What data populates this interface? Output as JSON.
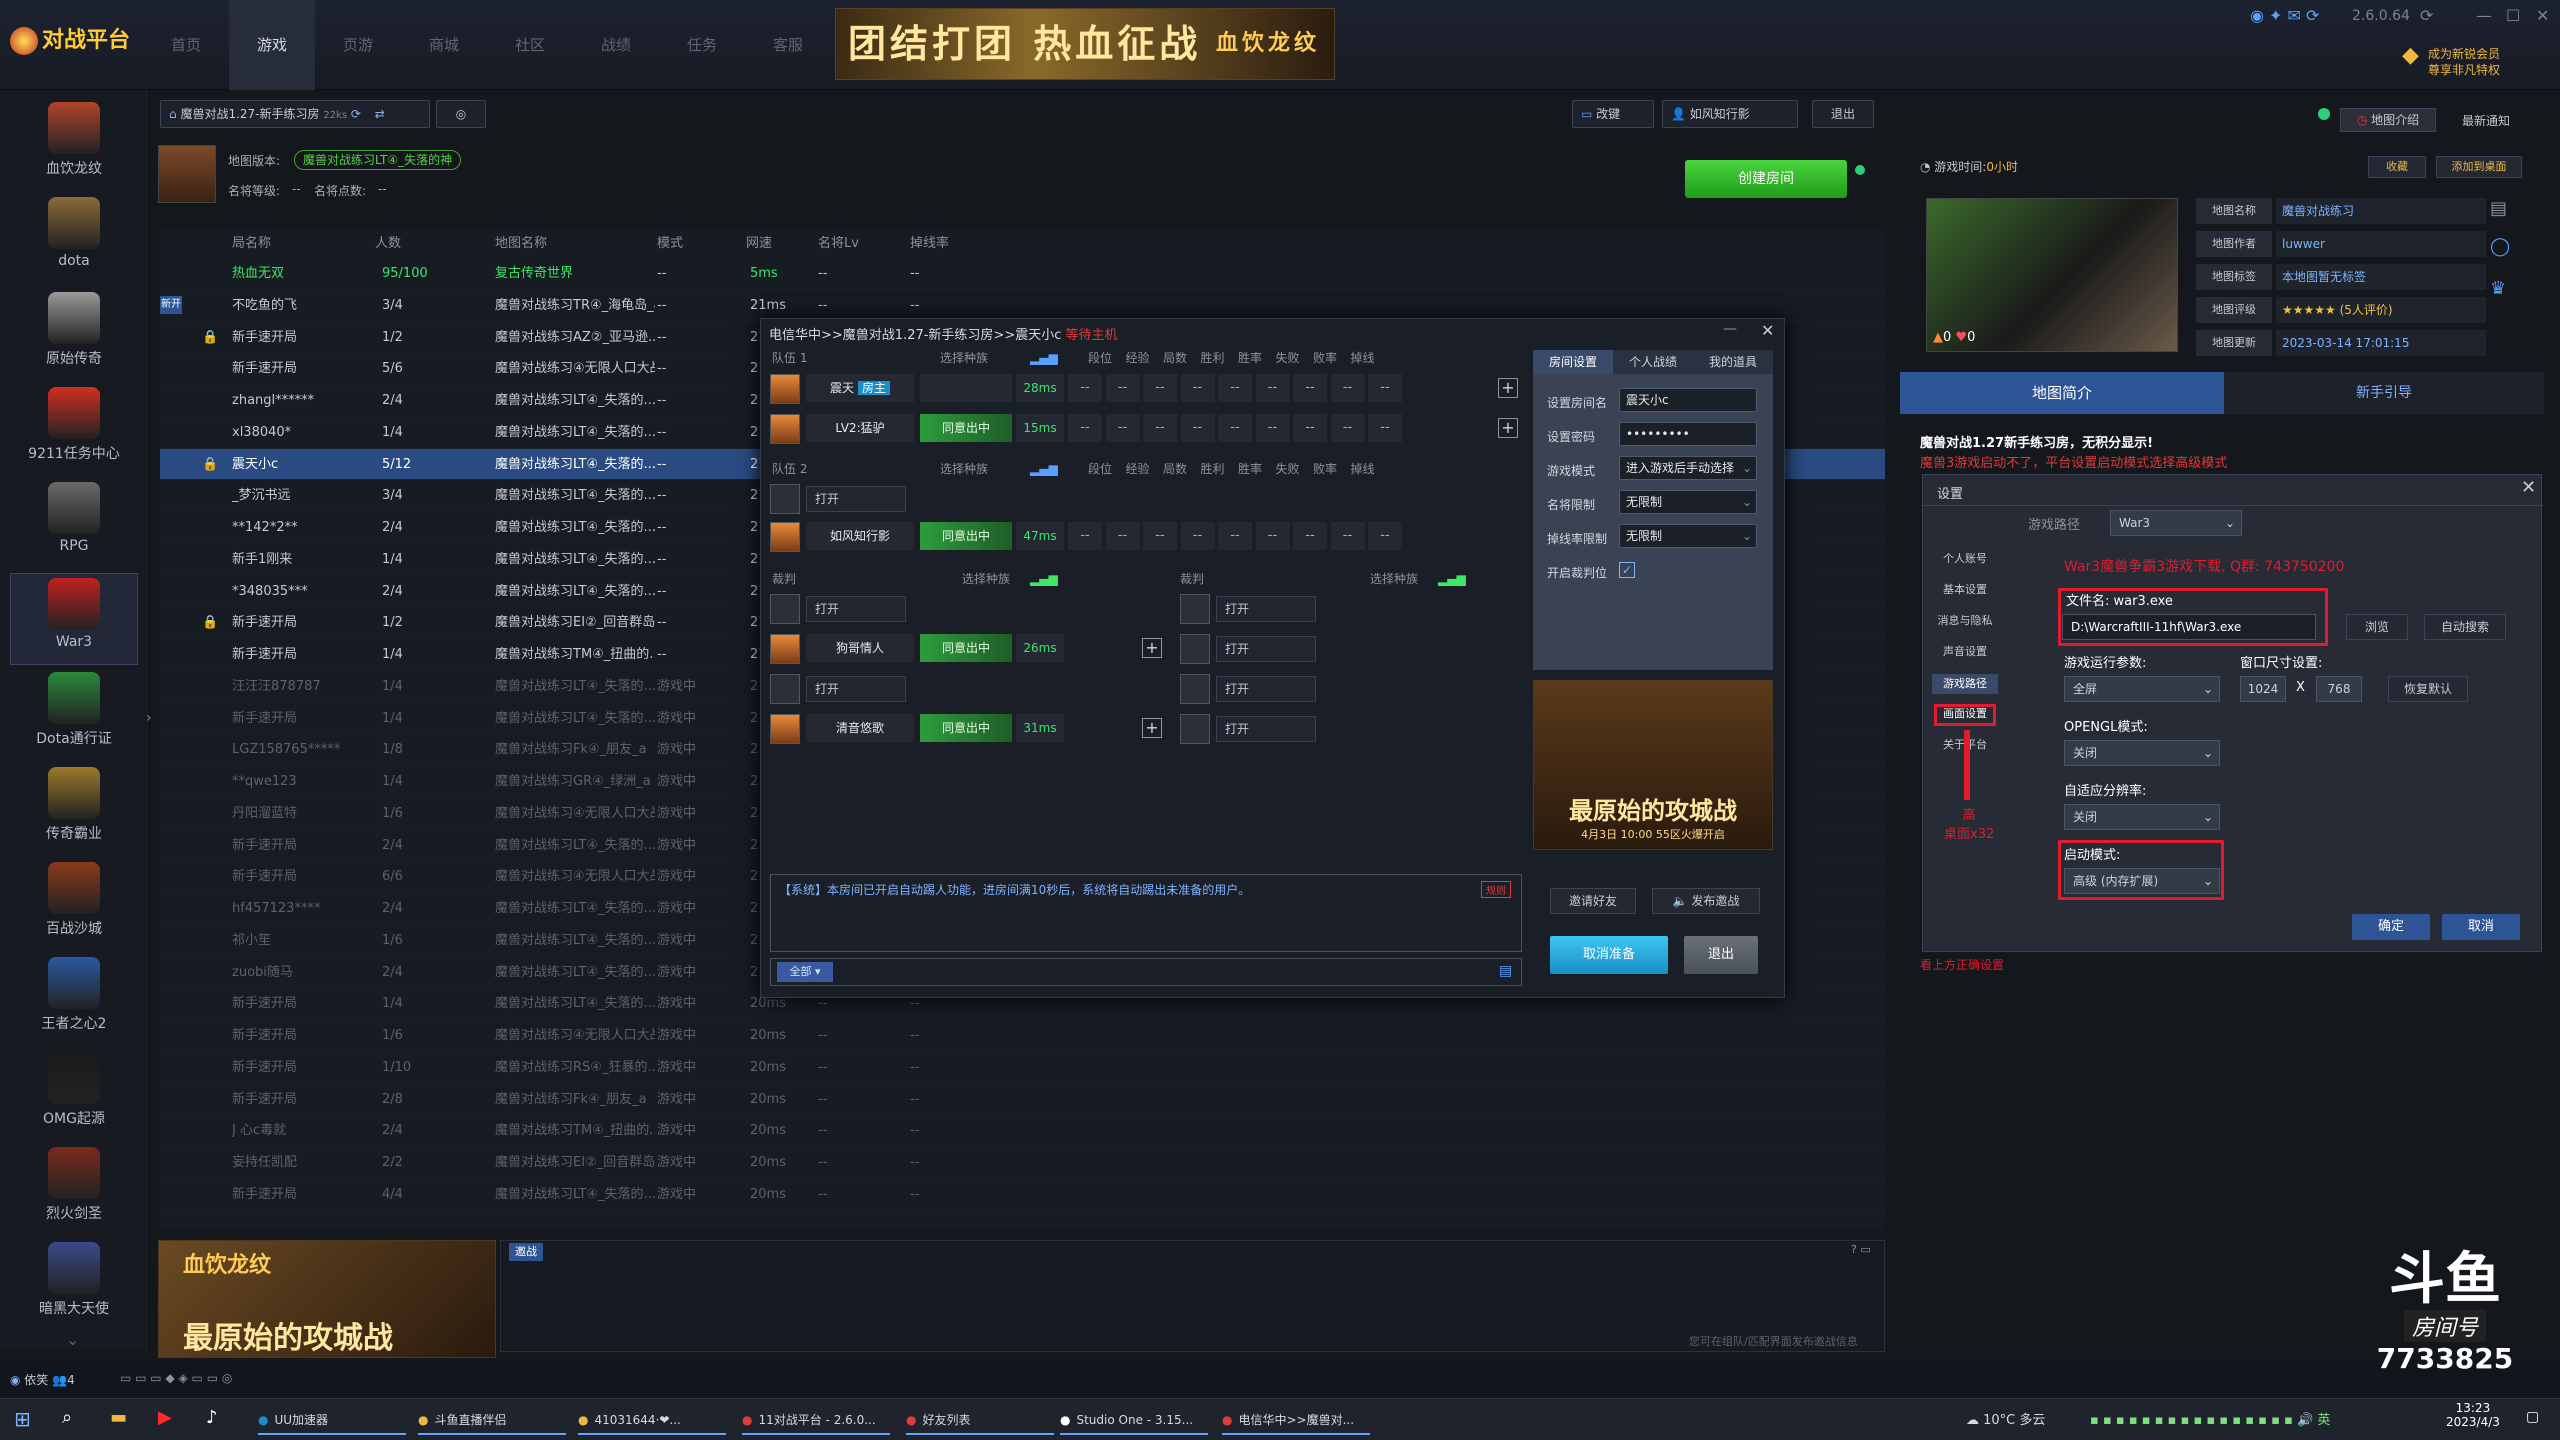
{
  "app": {
    "logo": "对战平台",
    "nav_tabs": [
      "首页",
      "游戏",
      "页游",
      "商城",
      "社区",
      "战绩",
      "任务",
      "客服"
    ],
    "version": "2.6.0.64",
    "vip_text_1": "成为新锐会员",
    "vip_text_2": "尊享非凡特权",
    "banner_text": "团结打团 热血征战",
    "banner_badge": "血饮龙纹"
  },
  "sidebar": [
    {
      "label": "血饮龙纹",
      "color": "#b0452a"
    },
    {
      "label": "dota",
      "color": "#8a6a3a"
    },
    {
      "label": "原始传奇",
      "color": "#9a9a9a"
    },
    {
      "label": "9211任务中心",
      "color": "#d03020"
    },
    {
      "label": "RPG",
      "color": "#6a6a6a"
    },
    {
      "label": "War3",
      "color": "#c02020"
    },
    {
      "label": "Dota通行证",
      "color": "#2a8a3a"
    },
    {
      "label": "传奇霸业",
      "color": "#9a7a2a"
    },
    {
      "label": "百战沙城",
      "color": "#8a3a1a"
    },
    {
      "label": "王者之心2",
      "color": "#2a5aa0"
    },
    {
      "label": "OMG起源",
      "color": "#1a1a1a"
    },
    {
      "label": "烈火剑圣",
      "color": "#7a2a1a"
    },
    {
      "label": "暗黑大天使",
      "color": "#3a4a8a"
    }
  ],
  "toolbar": {
    "room_path": "魔兽对战1.27-新手练习房",
    "room_count": "22ks",
    "btn_reconnect": "改键",
    "btn_fly": "如风知行影",
    "btn_exit": "退出",
    "create_room": "创建房间",
    "map_version_label": "地图版本:",
    "map_version_value": "魔兽对战练习LT④_失落的神",
    "fame_label": "名将等级:",
    "fame_value": "--",
    "fame_points_label": "名将点数:",
    "fame_points_value": "--"
  },
  "room_table": {
    "headers": [
      "局名称",
      "人数",
      "地图名称",
      "模式",
      "网速",
      "名将Lv",
      "掉线率"
    ],
    "rows": [
      [
        "热血无双",
        "95/100",
        "复古传奇世界",
        "--",
        "5ms",
        "--",
        "--"
      ],
      [
        "不吃鱼的飞",
        "3/4",
        "魔兽对战练习TR④_海龟岛_a",
        "--",
        "21ms",
        "--",
        "--"
      ],
      [
        "新手速开局",
        "1/2",
        "魔兽对战练习AZ②_亚马逊...",
        "--",
        "21",
        "",
        ""
      ],
      [
        "新手速开局",
        "5/6",
        "魔兽对战练习④无限人口大战",
        "--",
        "21",
        "",
        ""
      ],
      [
        "zhangl******",
        "2/4",
        "魔兽对战练习LT④_失落的...",
        "--",
        "21",
        "",
        ""
      ],
      [
        "xl38040*",
        "1/4",
        "魔兽对战练习LT④_失落的...",
        "--",
        "21",
        "",
        ""
      ],
      [
        "震天小c",
        "5/12",
        "魔兽对战练习LT④_失落的...",
        "--",
        "21",
        "",
        ""
      ],
      [
        "_梦沉书远",
        "3/4",
        "魔兽对战练习LT④_失落的...",
        "--",
        "21",
        "",
        ""
      ],
      [
        "**142*2**",
        "2/4",
        "魔兽对战练习LT④_失落的...",
        "--",
        "21",
        "",
        ""
      ],
      [
        "新手1刚来",
        "1/4",
        "魔兽对战练习LT④_失落的...",
        "--",
        "21",
        "",
        ""
      ],
      [
        "*348035***",
        "2/4",
        "魔兽对战练习LT④_失落的...",
        "--",
        "21",
        "",
        ""
      ],
      [
        "新手速开局",
        "1/2",
        "魔兽对战练习EI②_回音群岛",
        "--",
        "21",
        "",
        ""
      ],
      [
        "新手速开局",
        "1/4",
        "魔兽对战练习TM④_扭曲的...",
        "--",
        "21",
        "",
        ""
      ],
      [
        "汪汪汪878787",
        "1/4",
        "魔兽对战练习LT④_失落的...",
        "游戏中",
        "21",
        "",
        ""
      ],
      [
        "新手速开局",
        "1/4",
        "魔兽对战练习LT④_失落的...",
        "游戏中",
        "21",
        "",
        ""
      ],
      [
        "LGZ158765*****",
        "1/8",
        "魔兽对战练习Fk④_朋友_a",
        "游戏中",
        "21",
        "",
        ""
      ],
      [
        "**qwe123",
        "1/4",
        "魔兽对战练习GR④_绿洲_a",
        "游戏中",
        "21",
        "",
        ""
      ],
      [
        "丹阳溜蓝特",
        "1/6",
        "魔兽对战练习④无限人口大战",
        "游戏中",
        "21",
        "",
        ""
      ],
      [
        "新手速开局",
        "2/4",
        "魔兽对战练习LT④_失落的...",
        "游戏中",
        "21",
        "",
        ""
      ],
      [
        "新手速开局",
        "6/6",
        "魔兽对战练习④无限人口大战",
        "游戏中",
        "21",
        "",
        ""
      ],
      [
        "hf457123****",
        "2/4",
        "魔兽对战练习LT④_失落的...",
        "游戏中",
        "21",
        "",
        ""
      ],
      [
        "祁小笙",
        "1/6",
        "魔兽对战练习LT④_失落的...",
        "游戏中",
        "21",
        "",
        ""
      ],
      [
        "zuobi随马",
        "2/4",
        "魔兽对战练习LT④_失落的...",
        "游戏中",
        "21",
        "",
        ""
      ],
      [
        "新手速开局",
        "1/4",
        "魔兽对战练习LT④_失落的...",
        "游戏中",
        "20ms",
        "--",
        "--"
      ],
      [
        "新手速开局",
        "1/6",
        "魔兽对战练习④无限人口大战",
        "游戏中",
        "20ms",
        "--",
        "--"
      ],
      [
        "新手速开局",
        "1/10",
        "魔兽对战练习RS④_狂暴的...",
        "游戏中",
        "20ms",
        "--",
        "--"
      ],
      [
        "新手速开局",
        "2/8",
        "魔兽对战练习Fk④_朋友_a",
        "游戏中",
        "20ms",
        "--",
        "--"
      ],
      [
        "J 心c毒就",
        "2/4",
        "魔兽对战练习TM④_扭曲的...",
        "游戏中",
        "20ms",
        "--",
        "--"
      ],
      [
        "妄持任凯配",
        "2/2",
        "魔兽对战练习EI②_回音群岛",
        "游戏中",
        "20ms",
        "--",
        "--"
      ],
      [
        "新手速开局",
        "4/4",
        "魔兽对战练习LT④_失落的...",
        "游戏中",
        "20ms",
        "--",
        "--"
      ]
    ]
  },
  "dialog": {
    "title": "电信华中>>魔兽对战1.27-新手练习房>>震天小c",
    "title_warn": "等待主机",
    "team1": "队伍 1",
    "team2": "队伍 2",
    "referee": "裁判",
    "col_headers": [
      "选择种族",
      "段位",
      "经验",
      "局数",
      "胜利",
      "胜率",
      "失败",
      "败率",
      "掉线"
    ],
    "team1_players": [
      {
        "name": "震天",
        "tag": "房主",
        "ping": "28ms",
        "ready": ""
      },
      {
        "name": "LV2:猛驴",
        "tag": "",
        "ping": "15ms",
        "ready": "同意出中"
      }
    ],
    "team2_players": [
      {
        "name": "",
        "open": "打开"
      },
      {
        "name": "如风知行影",
        "ping": "47ms",
        "ready": "同意出中"
      }
    ],
    "referee_left": [
      {
        "open": "打开"
      },
      {
        "name": "狗哥情人",
        "ping": "26ms",
        "ready": "同意出中"
      },
      {
        "open": "打开"
      },
      {
        "name": "清音悠歌",
        "ping": "31ms",
        "ready": "同意出中"
      }
    ],
    "referee_right": [
      "打开",
      "打开",
      "打开",
      "打开"
    ],
    "dash": "--",
    "chat_msg": "【系统】本房间已开启自动踢人功能，进房间满10秒后，系统将自动踢出未准备的用户。",
    "chat_badge": "规则",
    "chat_scope": "全部",
    "settings_tabs": [
      "房间设置",
      "个人战绩",
      "我的道具"
    ],
    "settings": {
      "name_label": "设置房间名",
      "name_value": "震天小c",
      "pwd_label": "设置密码",
      "pwd_value": "•••••••••",
      "mode_label": "游戏模式",
      "mode_value": "进入游戏后手动选择",
      "fame_label": "名将限制",
      "fame_value": "无限制",
      "drop_label": "掉线率限制",
      "drop_value": "无限制",
      "referee_label": "开启裁判位"
    },
    "ad_title": "最原始的攻城战",
    "ad_date": "4月3日 10:00 55区火爆开启",
    "btn_invite": "邀请好友",
    "btn_broadcast": "发布邀战",
    "btn_cancel_ready": "取消准备",
    "btn_exit": "退出"
  },
  "right_panel": {
    "game_time_label": "游戏时间:",
    "game_time_value": "0小时",
    "btn_map_intro": "地图介绍",
    "btn_news": "最新通知",
    "btn_fav": "收藏",
    "btn_desktop": "添加到桌面",
    "info": [
      {
        "k": "地图名称",
        "v": "魔兽对战练习"
      },
      {
        "k": "地图作者",
        "v": "luwwer"
      },
      {
        "k": "地图标签",
        "v": "本地图暂无标签"
      },
      {
        "k": "地图评级",
        "v": "★★★★★ (5人评价)"
      },
      {
        "k": "地图更新",
        "v": "2023-03-14 17:01:15"
      }
    ],
    "tab_intro": "地图简介",
    "tab_guide": "新手引导",
    "intro_line1": "魔兽对战1.27新手练习房，无积分显示!",
    "intro_line2": "魔兽3游戏启动不了，平台设置启动模式选择高级模式",
    "fire_count": "0",
    "heart_count": "0"
  },
  "settings_dialog": {
    "title": "设置",
    "nav": [
      "个人账号",
      "基本设置",
      "消息与隐私",
      "声音设置",
      "游戏路径",
      "画面设置",
      "关于平台"
    ],
    "path_label": "游戏路径",
    "path_select": "War3",
    "note": "War3魔兽争霸3游戏下载, Q群: 743750200",
    "file_label": "文件名: war3.exe",
    "file_path": "D:\\WarcraftIII-11hf\\War3.exe",
    "btn_browse": "浏览",
    "btn_auto": "自动搜索",
    "args_label": "游戏运行参数:",
    "args_value": "全屏",
    "winsize_label": "窗口尺寸设置:",
    "win_w": "1024",
    "win_x": "X",
    "win_h": "768",
    "btn_default": "恢复默认",
    "opengl_label": "OPENGL模式:",
    "opengl_value": "关闭",
    "adapt_label": "自适应分辨率:",
    "adapt_value": "关闭",
    "launch_label": "启动模式:",
    "launch_value": "高级 (内存扩展)",
    "annotation": "高\n桌面x32",
    "btn_ok": "确定",
    "btn_cancel": "取消",
    "footer": "看上方正确设置"
  },
  "bottom": {
    "promo_title": "最原始的攻城战",
    "promo_badge": "血饮龙纹",
    "chat_tab": "邀战",
    "chat_hint": "您可在组队/匹配界面发布邀战信息",
    "status_user": "依笑",
    "status_count": "4",
    "watermark_room_label": "房间号",
    "watermark_room_no": "7733825"
  },
  "taskbar": {
    "items": [
      "UU加速器",
      "斗鱼直播伴侣",
      "41031644·❤...",
      "11对战平台 - 2.6.0...",
      "好友列表",
      "Studio One - 3.15...",
      "电信华中>>魔兽对..."
    ],
    "weather": "10°C 多云",
    "time": "13:23",
    "date": "2023/4/3"
  }
}
